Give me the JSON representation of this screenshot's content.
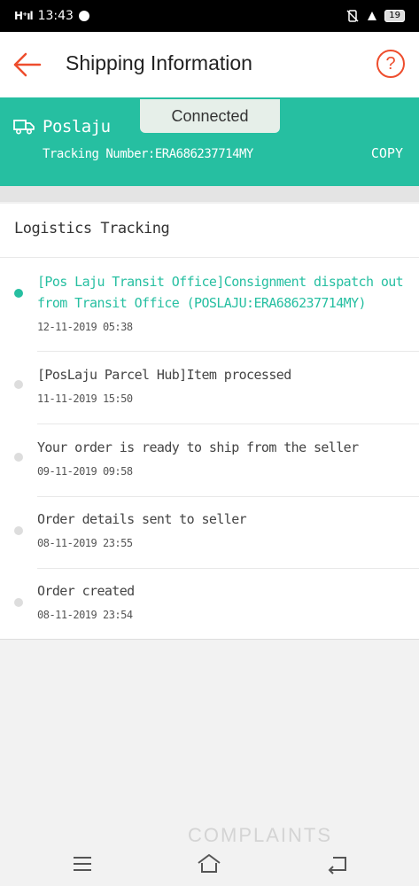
{
  "status_bar": {
    "time": "13:43",
    "signal": "H⁺ıl",
    "battery": "19"
  },
  "header": {
    "title": "Shipping Information",
    "help_symbol": "?"
  },
  "toast": {
    "text": "Connected"
  },
  "carrier": {
    "name": "Poslaju",
    "tracking_label": "Tracking Number:",
    "tracking_number": "ERA686237714MY",
    "copy_label": "COPY",
    "color": "#26bfa1"
  },
  "logistics": {
    "title": "Logistics Tracking",
    "events": [
      {
        "description": "[Pos Laju Transit Office]Consignment dispatch out from Transit Office (POSLAJU:ERA686237714MY)",
        "time": "12-11-2019 05:38",
        "active": true
      },
      {
        "description": "[PosLaju Parcel Hub]Item processed",
        "time": "11-11-2019 15:50",
        "active": false
      },
      {
        "description": "Your order is ready to ship from the seller",
        "time": "09-11-2019 09:58",
        "active": false
      },
      {
        "description": "Order details sent to seller",
        "time": "08-11-2019 23:55",
        "active": false
      },
      {
        "description": "Order created",
        "time": "08-11-2019 23:54",
        "active": false
      }
    ]
  },
  "watermark": {
    "text": "COMPLAINTS"
  },
  "colors": {
    "accent": "#ee4d2d",
    "teal": "#26bfa1"
  },
  "icons": [
    "back-arrow-icon",
    "help-icon",
    "truck-icon",
    "menu-icon",
    "home-icon",
    "back-nav-icon"
  ]
}
